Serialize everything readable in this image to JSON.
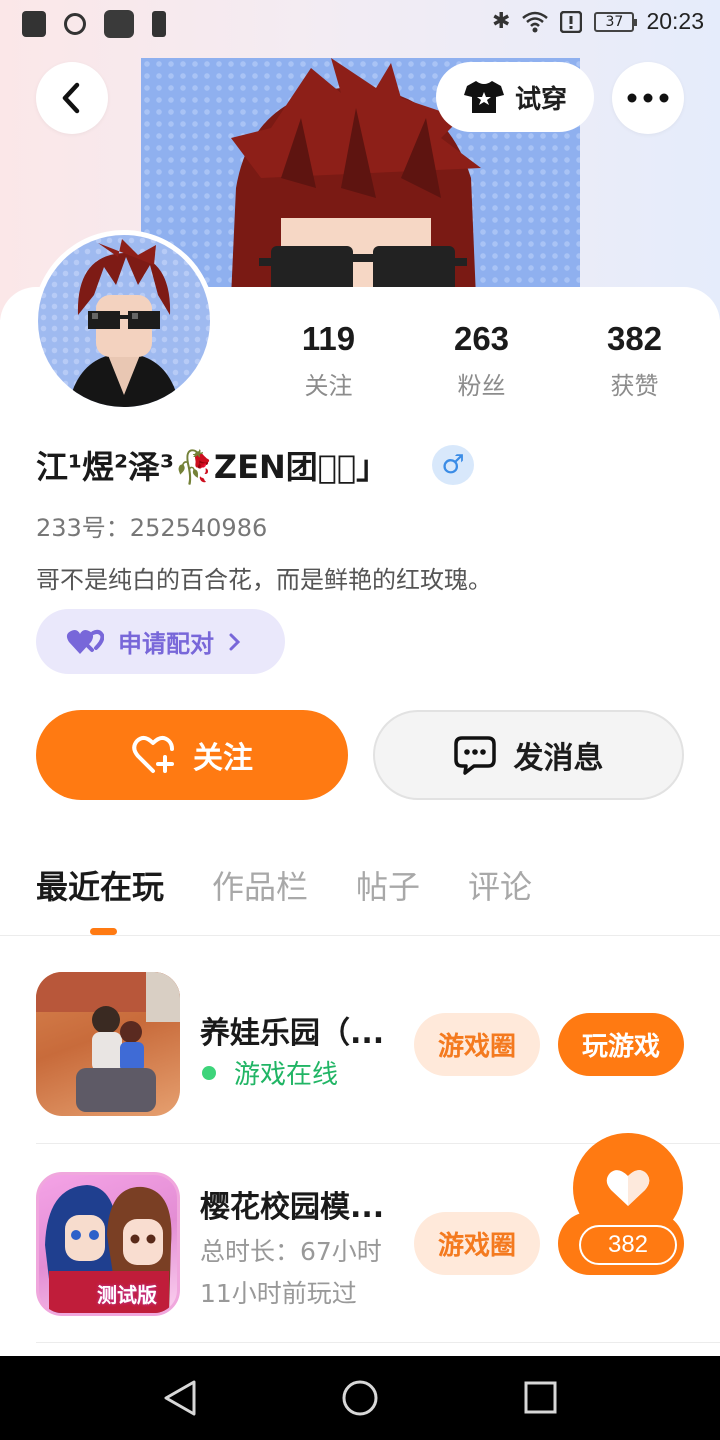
{
  "status_bar": {
    "time": "20:23",
    "battery": "37",
    "icons": [
      "sd-card-icon",
      "hotspot-icon",
      "app-icon",
      "battery-alert-icon",
      "bluetooth-icon",
      "wifi-icon",
      "alert-icon"
    ]
  },
  "header": {
    "try_on_label": "试穿"
  },
  "profile": {
    "nickname": "江¹煜²泽³🥀ZEN团「⃢」",
    "gender_symbol": "♂",
    "uid": "233号：252540986",
    "bio": "哥不是纯白的百合花，而是鲜艳的红玫瑰。",
    "stats": [
      {
        "value": "119",
        "label": "关注"
      },
      {
        "value": "263",
        "label": "粉丝"
      },
      {
        "value": "382",
        "label": "获赞"
      }
    ]
  },
  "actions": {
    "pair_label": "申请配对",
    "follow_label": "关注",
    "message_label": "发消息"
  },
  "tabs": [
    {
      "label": "最近在玩",
      "active": true
    },
    {
      "label": "作品栏",
      "active": false
    },
    {
      "label": "帖子",
      "active": false
    },
    {
      "label": "评论",
      "active": false
    }
  ],
  "games": [
    {
      "title": "养娃乐园（...",
      "status": "游戏在线",
      "circle_label": "游戏圈",
      "play_label": "玩游戏"
    },
    {
      "title": "樱花校园模...",
      "playtime": "总时长：67小时",
      "last_played": "11小时前玩过",
      "circle_label": "游戏圈",
      "badge_text": "测试版"
    }
  ],
  "like_fab": {
    "count": "382"
  },
  "colors": {
    "accent": "#ff7a12",
    "pair_purple": "#7867d9",
    "online_green": "#21b565"
  }
}
